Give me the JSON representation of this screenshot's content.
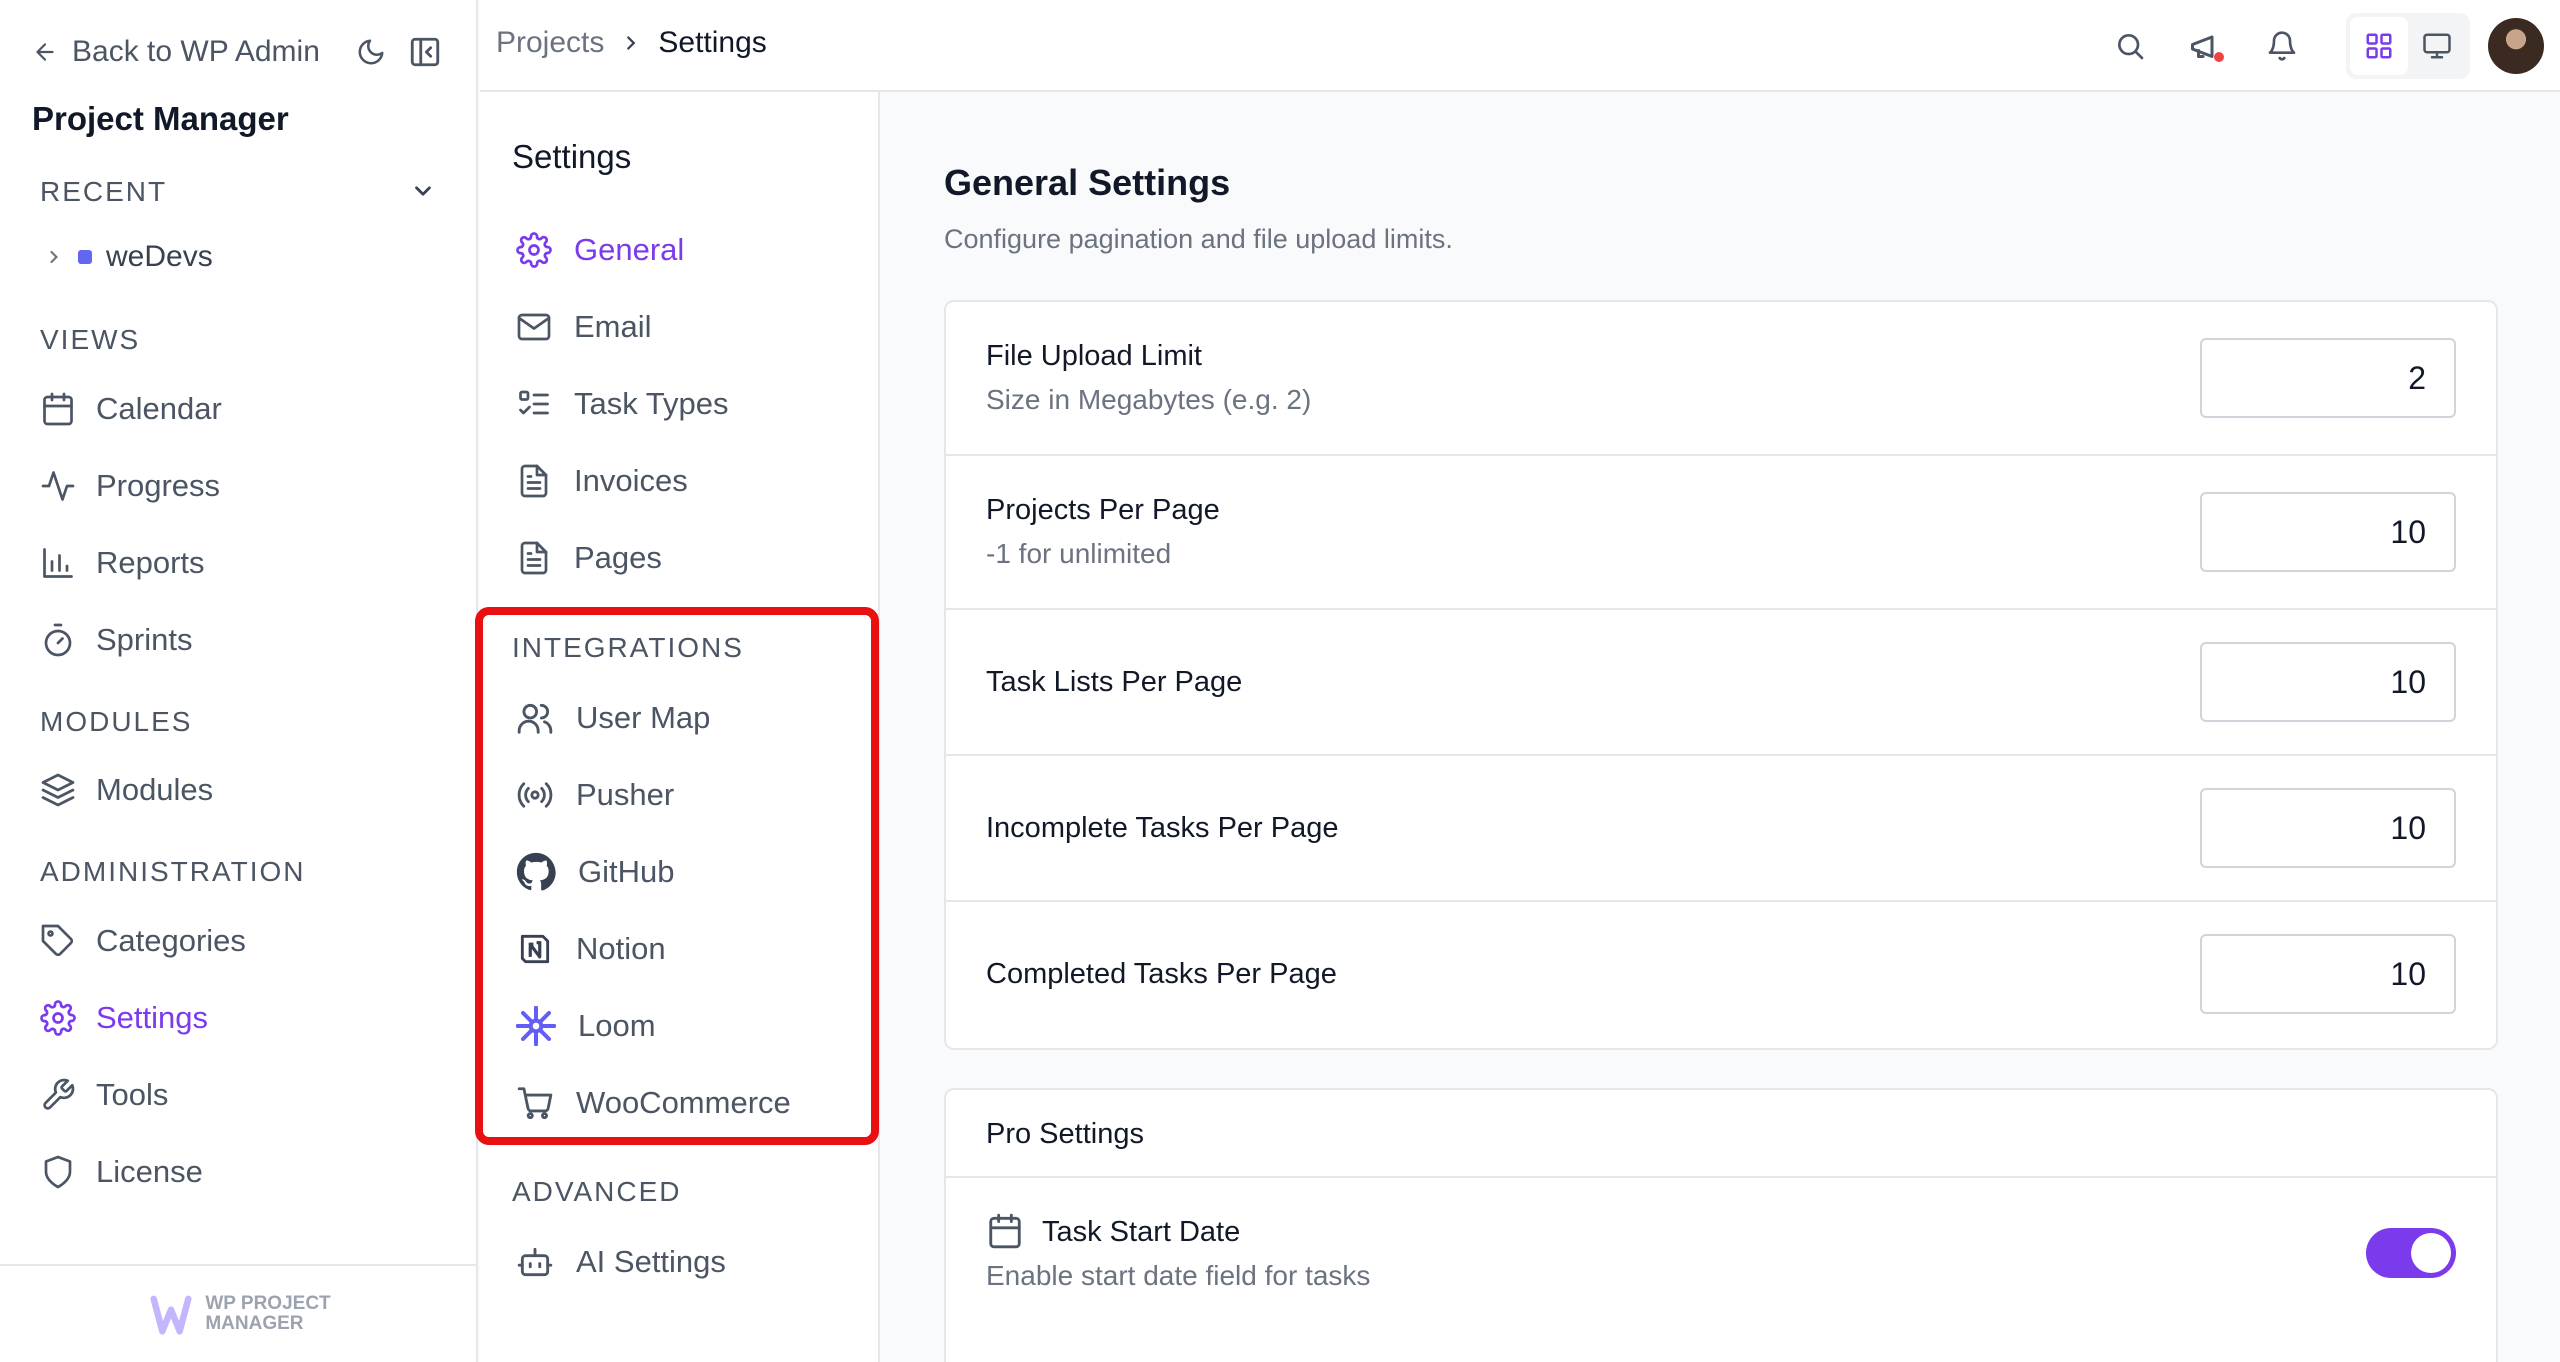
{
  "sidebar": {
    "back_label": "Back to WP Admin",
    "brand": "Project Manager",
    "recent_heading": "RECENT",
    "recent_items": [
      {
        "label": "weDevs"
      }
    ],
    "views_heading": "VIEWS",
    "views": [
      {
        "label": "Calendar",
        "icon": "calendar-icon"
      },
      {
        "label": "Progress",
        "icon": "activity-icon"
      },
      {
        "label": "Reports",
        "icon": "bar-chart-icon"
      },
      {
        "label": "Sprints",
        "icon": "timer-icon"
      }
    ],
    "modules_heading": "MODULES",
    "modules": [
      {
        "label": "Modules",
        "icon": "layers-icon"
      }
    ],
    "admin_heading": "ADMINISTRATION",
    "admin": [
      {
        "label": "Categories",
        "icon": "tag-icon"
      },
      {
        "label": "Settings",
        "icon": "gear-icon",
        "active": true
      },
      {
        "label": "Tools",
        "icon": "wrench-icon"
      },
      {
        "label": "License",
        "icon": "shield-icon"
      }
    ],
    "footer_logo_line1": "WP PROJECT",
    "footer_logo_line2": "MANAGER"
  },
  "topbar": {
    "breadcrumb": [
      "Projects",
      "Settings"
    ]
  },
  "settings_nav": {
    "title": "Settings",
    "items": [
      {
        "label": "General",
        "icon": "gear-icon",
        "active": true
      },
      {
        "label": "Email",
        "icon": "mail-icon"
      },
      {
        "label": "Task Types",
        "icon": "list-check-icon"
      },
      {
        "label": "Invoices",
        "icon": "file-text-icon"
      },
      {
        "label": "Pages",
        "icon": "file-text-icon"
      }
    ],
    "integrations_heading": "INTEGRATIONS",
    "integrations": [
      {
        "label": "User Map",
        "icon": "users-icon"
      },
      {
        "label": "Pusher",
        "icon": "radio-icon"
      },
      {
        "label": "GitHub",
        "icon": "github-icon"
      },
      {
        "label": "Notion",
        "icon": "notion-icon"
      },
      {
        "label": "Loom",
        "icon": "loom-icon"
      },
      {
        "label": "WooCommerce",
        "icon": "cart-icon"
      }
    ],
    "advanced_heading": "ADVANCED",
    "advanced": [
      {
        "label": "AI Settings",
        "icon": "bot-icon"
      }
    ]
  },
  "main": {
    "title": "General Settings",
    "subtitle": "Configure pagination and file upload limits.",
    "fields": [
      {
        "label": "File Upload Limit",
        "desc": "Size in Megabytes (e.g. 2)",
        "value": "2"
      },
      {
        "label": "Projects Per Page",
        "desc": "-1 for unlimited",
        "value": "10"
      },
      {
        "label": "Task Lists Per Page",
        "desc": "",
        "value": "10"
      },
      {
        "label": "Incomplete Tasks Per Page",
        "desc": "",
        "value": "10"
      },
      {
        "label": "Completed Tasks Per Page",
        "desc": "",
        "value": "10"
      }
    ],
    "pro": {
      "heading": "Pro Settings",
      "items": [
        {
          "label": "Task Start Date",
          "desc": "Enable start date field for tasks",
          "enabled": true
        }
      ]
    }
  },
  "colors": {
    "accent": "#7c3aed",
    "highlight": "#e81010"
  }
}
